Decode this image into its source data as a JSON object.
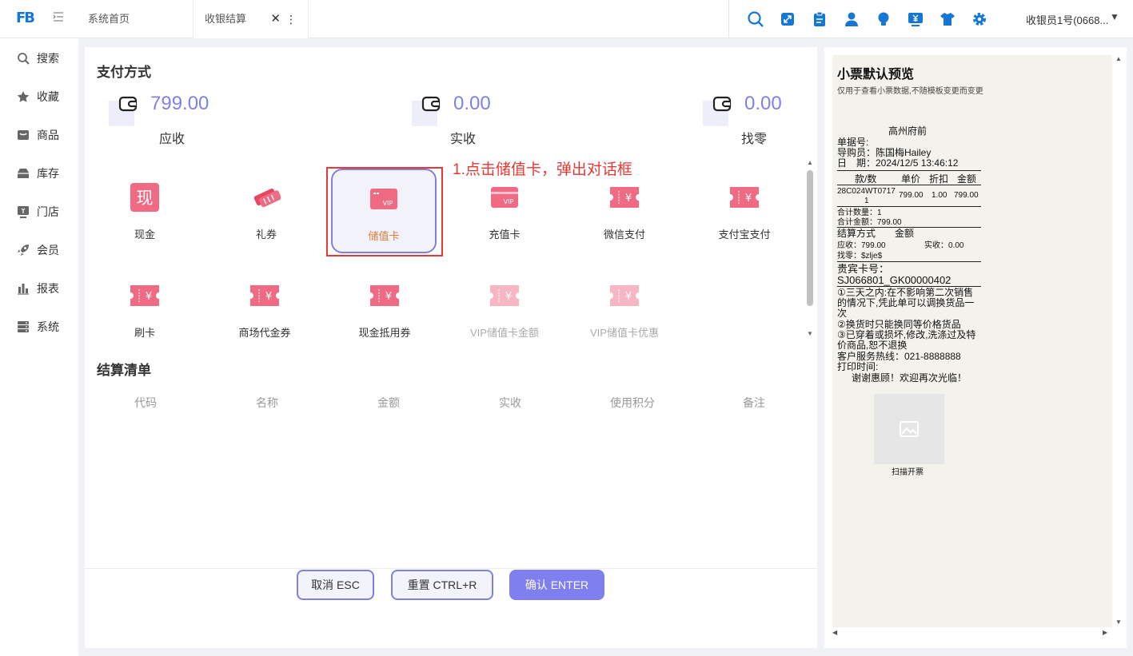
{
  "header": {
    "logo_text": "FB",
    "tabs": [
      {
        "label": "系统首页"
      },
      {
        "label": "收银结算"
      }
    ],
    "close_glyph": "✕",
    "more_glyph": "⋮",
    "tool_icons": [
      "search-icon",
      "fullscreen-icon",
      "clipboard-icon",
      "user-icon",
      "bulb-icon",
      "cashier-icon",
      "shirt-icon",
      "gear-icon"
    ],
    "user": "收银员1号(0668...",
    "accent_color": "#1677d2"
  },
  "sidebar": {
    "items": [
      {
        "label": "搜索",
        "icon": "search-icon"
      },
      {
        "label": "收藏",
        "icon": "star-icon"
      },
      {
        "label": "商品",
        "icon": "goods-icon"
      },
      {
        "label": "库存",
        "icon": "inventory-icon"
      },
      {
        "label": "门店",
        "icon": "store-icon"
      },
      {
        "label": "会员",
        "icon": "rocket-icon"
      },
      {
        "label": "报表",
        "icon": "report-icon"
      },
      {
        "label": "系统",
        "icon": "system-icon"
      }
    ]
  },
  "payment": {
    "title": "支付方式",
    "amounts": [
      {
        "value": "799.00",
        "label": "应收"
      },
      {
        "value": "0.00",
        "label": "实收"
      },
      {
        "value": "0.00",
        "label": "找零"
      }
    ],
    "methods": [
      {
        "label": "现金",
        "icon": "cash-icon",
        "icon_text": "现"
      },
      {
        "label": "礼券",
        "icon": "ticket-icon"
      },
      {
        "label": "储值卡",
        "icon": "vip-card-icon",
        "icon_text": "VIP"
      },
      {
        "label": "充值卡",
        "icon": "recharge-card-icon",
        "icon_text": "VIP"
      },
      {
        "label": "微信支付",
        "icon": "coupon-yen-icon",
        "icon_text": "¥"
      },
      {
        "label": "支付宝支付",
        "icon": "coupon-yen-icon",
        "icon_text": "¥"
      },
      {
        "label": "刷卡",
        "icon": "coupon-yen-icon",
        "icon_text": "¥"
      },
      {
        "label": "商场代金券",
        "icon": "coupon-yen-icon",
        "icon_text": "¥"
      },
      {
        "label": "现金抵用券",
        "icon": "coupon-yen-icon",
        "icon_text": "¥"
      },
      {
        "label": "VIP储值卡金额",
        "icon": "coupon-yen-icon",
        "icon_text": "¥"
      },
      {
        "label": "VIP储值卡优惠",
        "icon": "coupon-yen-icon",
        "icon_text": "¥"
      }
    ],
    "annotation": "1.点击储值卡，弹出对话框",
    "icon_color": "#f06a84"
  },
  "settlement": {
    "title": "结算清单",
    "columns": [
      "代码",
      "名称",
      "金额",
      "实收",
      "使用积分",
      "备注"
    ]
  },
  "actions": {
    "cancel": "取消 ESC",
    "reset": "重置 CTRL+R",
    "confirm": "确认 ENTER",
    "primary_color": "#7f7ff0"
  },
  "receipt": {
    "title": "小票默认预览",
    "subtitle": "仅用于查看小票数据,不随模板变更而变更",
    "store": "高州府前",
    "order_no": "单据号:",
    "guide": "导购员：陈国梅Hailey",
    "date": "日　期：2024/12/5 13:46:12",
    "table_header": [
      "款/数",
      "单价",
      "折扣",
      "金额"
    ],
    "item_code": "28C024WT0717",
    "item_qty": "1",
    "item_price": "799.00",
    "item_discount": "1.00",
    "item_amount": "799.00",
    "total_qty": "合计数量：1",
    "total_amount": "合计金额：799.00",
    "pay_header": "结算方式　　金额",
    "receivable": "应收：799.00",
    "received": "实收：0.00",
    "change": "找零：$zlje$",
    "vip_label": "贵宾卡号：",
    "vip_no": "SJ066801_GK00000402",
    "policy_1": "①三天之内:在不影响第二次销售的情况下,凭此单可以调换货品一次",
    "policy_2": "②换货时只能换同等价格货品",
    "policy_3": "③已穿着或损坏,修改,洗涤过及特价商品,恕不退换",
    "hotline": "客户服务热线：021-8888888",
    "print_time": "打印时间:",
    "thanks": "谢谢惠顾！欢迎再次光临！",
    "qr_label": "扫描开票"
  }
}
